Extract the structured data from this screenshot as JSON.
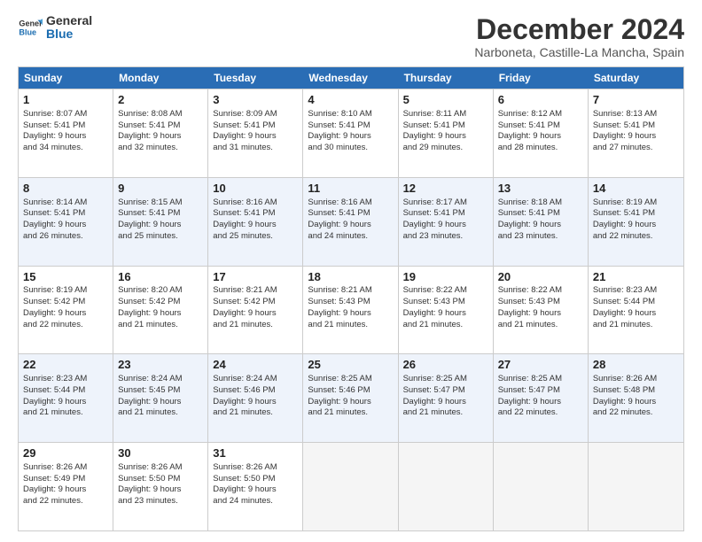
{
  "logo": {
    "line1": "General",
    "line2": "Blue"
  },
  "title": "December 2024",
  "subtitle": "Narboneta, Castille-La Mancha, Spain",
  "header_days": [
    "Sunday",
    "Monday",
    "Tuesday",
    "Wednesday",
    "Thursday",
    "Friday",
    "Saturday"
  ],
  "rows": [
    [
      {
        "day": "1",
        "lines": [
          "Sunrise: 8:07 AM",
          "Sunset: 5:41 PM",
          "Daylight: 9 hours",
          "and 34 minutes."
        ]
      },
      {
        "day": "2",
        "lines": [
          "Sunrise: 8:08 AM",
          "Sunset: 5:41 PM",
          "Daylight: 9 hours",
          "and 32 minutes."
        ]
      },
      {
        "day": "3",
        "lines": [
          "Sunrise: 8:09 AM",
          "Sunset: 5:41 PM",
          "Daylight: 9 hours",
          "and 31 minutes."
        ]
      },
      {
        "day": "4",
        "lines": [
          "Sunrise: 8:10 AM",
          "Sunset: 5:41 PM",
          "Daylight: 9 hours",
          "and 30 minutes."
        ]
      },
      {
        "day": "5",
        "lines": [
          "Sunrise: 8:11 AM",
          "Sunset: 5:41 PM",
          "Daylight: 9 hours",
          "and 29 minutes."
        ]
      },
      {
        "day": "6",
        "lines": [
          "Sunrise: 8:12 AM",
          "Sunset: 5:41 PM",
          "Daylight: 9 hours",
          "and 28 minutes."
        ]
      },
      {
        "day": "7",
        "lines": [
          "Sunrise: 8:13 AM",
          "Sunset: 5:41 PM",
          "Daylight: 9 hours",
          "and 27 minutes."
        ]
      }
    ],
    [
      {
        "day": "8",
        "lines": [
          "Sunrise: 8:14 AM",
          "Sunset: 5:41 PM",
          "Daylight: 9 hours",
          "and 26 minutes."
        ]
      },
      {
        "day": "9",
        "lines": [
          "Sunrise: 8:15 AM",
          "Sunset: 5:41 PM",
          "Daylight: 9 hours",
          "and 25 minutes."
        ]
      },
      {
        "day": "10",
        "lines": [
          "Sunrise: 8:16 AM",
          "Sunset: 5:41 PM",
          "Daylight: 9 hours",
          "and 25 minutes."
        ]
      },
      {
        "day": "11",
        "lines": [
          "Sunrise: 8:16 AM",
          "Sunset: 5:41 PM",
          "Daylight: 9 hours",
          "and 24 minutes."
        ]
      },
      {
        "day": "12",
        "lines": [
          "Sunrise: 8:17 AM",
          "Sunset: 5:41 PM",
          "Daylight: 9 hours",
          "and 23 minutes."
        ]
      },
      {
        "day": "13",
        "lines": [
          "Sunrise: 8:18 AM",
          "Sunset: 5:41 PM",
          "Daylight: 9 hours",
          "and 23 minutes."
        ]
      },
      {
        "day": "14",
        "lines": [
          "Sunrise: 8:19 AM",
          "Sunset: 5:41 PM",
          "Daylight: 9 hours",
          "and 22 minutes."
        ]
      }
    ],
    [
      {
        "day": "15",
        "lines": [
          "Sunrise: 8:19 AM",
          "Sunset: 5:42 PM",
          "Daylight: 9 hours",
          "and 22 minutes."
        ]
      },
      {
        "day": "16",
        "lines": [
          "Sunrise: 8:20 AM",
          "Sunset: 5:42 PM",
          "Daylight: 9 hours",
          "and 21 minutes."
        ]
      },
      {
        "day": "17",
        "lines": [
          "Sunrise: 8:21 AM",
          "Sunset: 5:42 PM",
          "Daylight: 9 hours",
          "and 21 minutes."
        ]
      },
      {
        "day": "18",
        "lines": [
          "Sunrise: 8:21 AM",
          "Sunset: 5:43 PM",
          "Daylight: 9 hours",
          "and 21 minutes."
        ]
      },
      {
        "day": "19",
        "lines": [
          "Sunrise: 8:22 AM",
          "Sunset: 5:43 PM",
          "Daylight: 9 hours",
          "and 21 minutes."
        ]
      },
      {
        "day": "20",
        "lines": [
          "Sunrise: 8:22 AM",
          "Sunset: 5:43 PM",
          "Daylight: 9 hours",
          "and 21 minutes."
        ]
      },
      {
        "day": "21",
        "lines": [
          "Sunrise: 8:23 AM",
          "Sunset: 5:44 PM",
          "Daylight: 9 hours",
          "and 21 minutes."
        ]
      }
    ],
    [
      {
        "day": "22",
        "lines": [
          "Sunrise: 8:23 AM",
          "Sunset: 5:44 PM",
          "Daylight: 9 hours",
          "and 21 minutes."
        ]
      },
      {
        "day": "23",
        "lines": [
          "Sunrise: 8:24 AM",
          "Sunset: 5:45 PM",
          "Daylight: 9 hours",
          "and 21 minutes."
        ]
      },
      {
        "day": "24",
        "lines": [
          "Sunrise: 8:24 AM",
          "Sunset: 5:46 PM",
          "Daylight: 9 hours",
          "and 21 minutes."
        ]
      },
      {
        "day": "25",
        "lines": [
          "Sunrise: 8:25 AM",
          "Sunset: 5:46 PM",
          "Daylight: 9 hours",
          "and 21 minutes."
        ]
      },
      {
        "day": "26",
        "lines": [
          "Sunrise: 8:25 AM",
          "Sunset: 5:47 PM",
          "Daylight: 9 hours",
          "and 21 minutes."
        ]
      },
      {
        "day": "27",
        "lines": [
          "Sunrise: 8:25 AM",
          "Sunset: 5:47 PM",
          "Daylight: 9 hours",
          "and 22 minutes."
        ]
      },
      {
        "day": "28",
        "lines": [
          "Sunrise: 8:26 AM",
          "Sunset: 5:48 PM",
          "Daylight: 9 hours",
          "and 22 minutes."
        ]
      }
    ],
    [
      {
        "day": "29",
        "lines": [
          "Sunrise: 8:26 AM",
          "Sunset: 5:49 PM",
          "Daylight: 9 hours",
          "and 22 minutes."
        ]
      },
      {
        "day": "30",
        "lines": [
          "Sunrise: 8:26 AM",
          "Sunset: 5:50 PM",
          "Daylight: 9 hours",
          "and 23 minutes."
        ]
      },
      {
        "day": "31",
        "lines": [
          "Sunrise: 8:26 AM",
          "Sunset: 5:50 PM",
          "Daylight: 9 hours",
          "and 24 minutes."
        ]
      },
      null,
      null,
      null,
      null
    ]
  ]
}
